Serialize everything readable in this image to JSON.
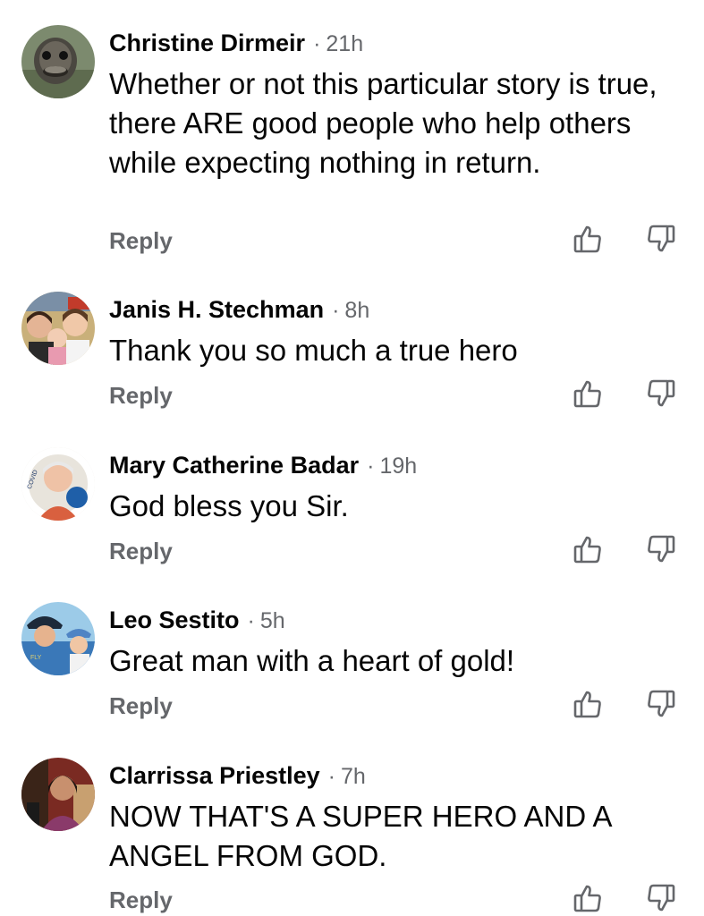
{
  "comments": [
    {
      "author": "Christine Dirmeir",
      "separator": "·",
      "time": "21h",
      "text": "Whether or not this particular story is true, there ARE good people who help others while expecting nothing in return.",
      "reply_label": "Reply",
      "avatar_icon": "emu-avatar"
    },
    {
      "author": "Janis H. Stechman",
      "separator": "·",
      "time": "8h",
      "text": "Thank you so much a true hero",
      "reply_label": "Reply",
      "avatar_icon": "family-photo-avatar"
    },
    {
      "author": "Mary Catherine Badar",
      "separator": "·",
      "time": "19h",
      "text": "God bless you Sir.",
      "reply_label": "Reply",
      "avatar_icon": "vaccine-frame-avatar"
    },
    {
      "author": "Leo Sestito",
      "separator": "·",
      "time": "5h",
      "text": "Great man with a heart of gold!",
      "reply_label": "Reply",
      "avatar_icon": "kids-photo-avatar"
    },
    {
      "author": "Clarrissa Priestley",
      "separator": "·",
      "time": "7h",
      "text": "NOW THAT'S A SUPER HERO AND A ANGEL FROM GOD.",
      "reply_label": "Reply",
      "avatar_icon": "portrait-avatar"
    }
  ],
  "icons": {
    "upvote": "thumbs-up-outline-icon",
    "downvote": "thumbs-down-outline-icon"
  },
  "colors": {
    "author": "#050505",
    "meta": "#65676b",
    "body": "#050505",
    "icon": "#65676b",
    "background": "#ffffff"
  }
}
